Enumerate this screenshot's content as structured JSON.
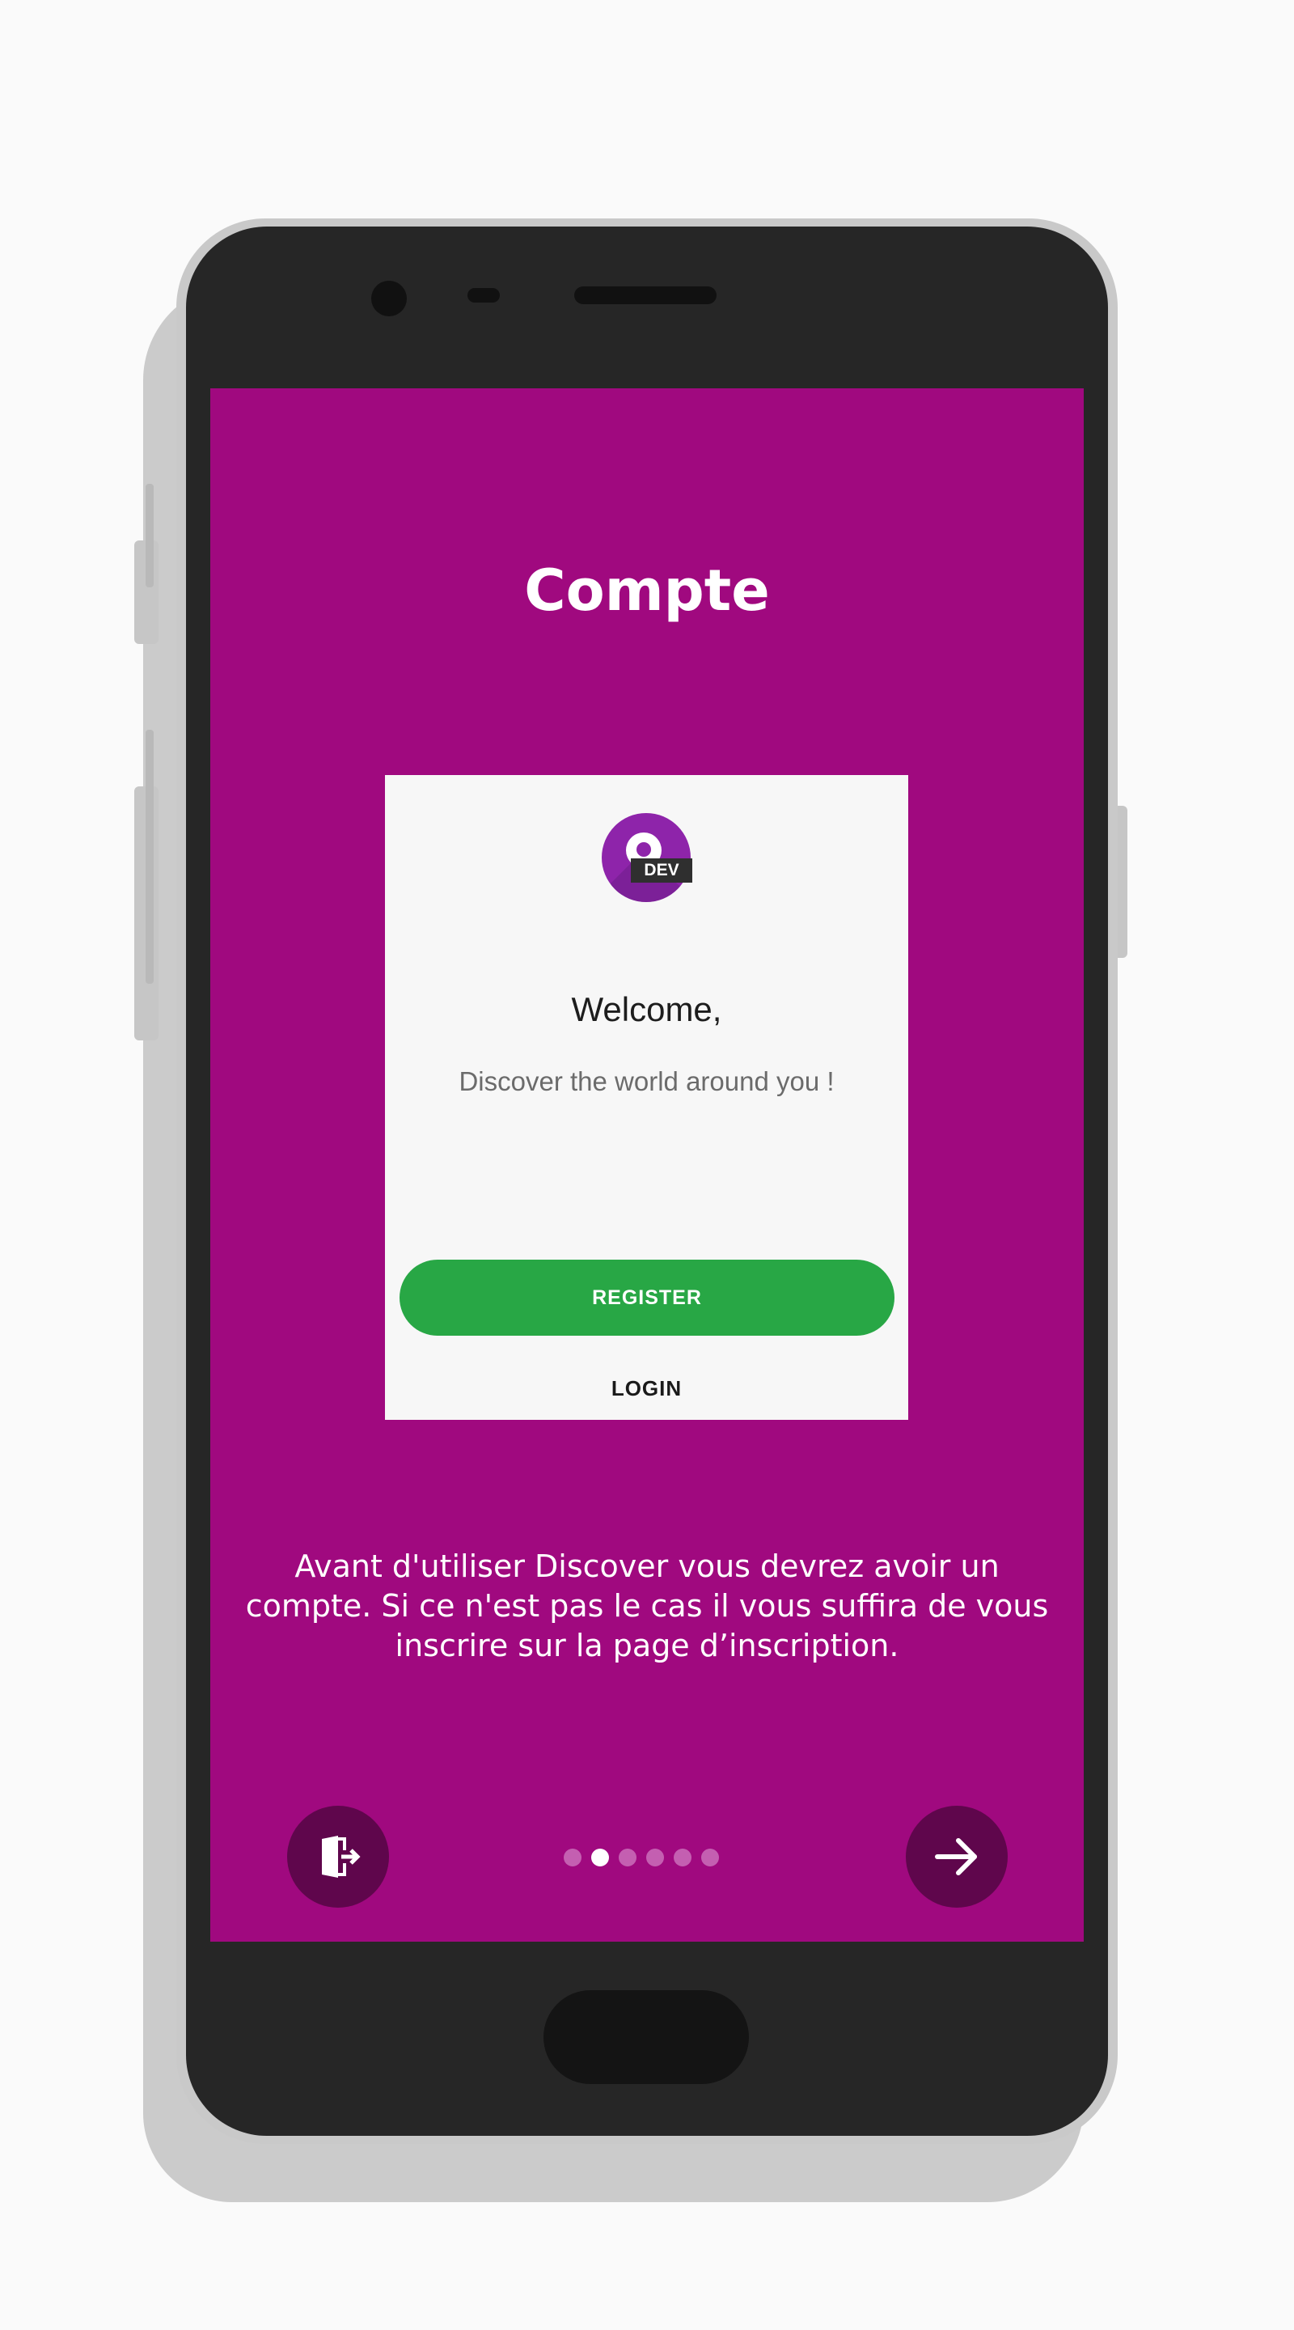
{
  "screen": {
    "title": "Compte",
    "background_color": "#a0097f",
    "description": "Avant d'utiliser Discover vous devrez avoir un compte. Si ce n'est pas le cas il vous suffira de vous inscrire sur la page d’inscription."
  },
  "preview": {
    "logo_icon": "lock-logo-icon",
    "badge": "DEV",
    "welcome": "Welcome,",
    "tagline": "Discover the world around you !",
    "register_label": "REGISTER",
    "register_color": "#28a745",
    "login_label": "LOGIN"
  },
  "navigation": {
    "skip_icon": "exit-door-icon",
    "next_icon": "arrow-right-icon",
    "page_count": 6,
    "current_page": 2
  }
}
